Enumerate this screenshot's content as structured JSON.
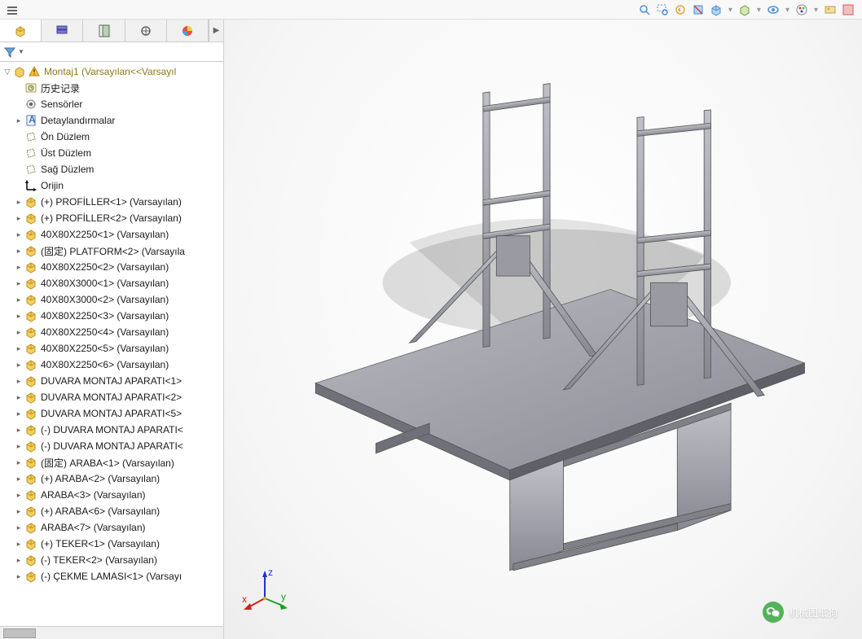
{
  "toolbar_right_icons": [
    "zoom-to-fit-icon",
    "zoom-area-icon",
    "previous-view-icon",
    "section-view-icon",
    "view-orient-icon",
    "display-style-icon",
    "hide-show-icon",
    "edit-appearance-icon",
    "apply-scene-icon",
    "view-settings-icon"
  ],
  "panel_tabs": [
    "assembly-tab-icon",
    "config-tab-icon",
    "property-tab-icon",
    "display-tab-icon",
    "appearance-tab-icon"
  ],
  "root": {
    "warn": true,
    "label": "Montaj1  (Varsayılan<<Varsayıl"
  },
  "tree": [
    {
      "icon": "history-icon",
      "label": "历史记录",
      "expand": false
    },
    {
      "icon": "sensor-icon",
      "label": "Sensörler",
      "expand": false
    },
    {
      "icon": "annot-icon",
      "label": "Detaylandırmalar",
      "expand": true
    },
    {
      "icon": "plane-icon",
      "label": "Ön Düzlem",
      "expand": false
    },
    {
      "icon": "plane-icon",
      "label": "Üst Düzlem",
      "expand": false
    },
    {
      "icon": "plane-icon",
      "label": "Sağ Düzlem",
      "expand": false
    },
    {
      "icon": "origin-icon",
      "label": "Orijin",
      "expand": false
    },
    {
      "icon": "part-icon",
      "label": "(+) PROFİLLER<1> (Varsayılan)",
      "expand": true
    },
    {
      "icon": "part-icon",
      "label": "(+) PROFİLLER<2> (Varsayılan)",
      "expand": true
    },
    {
      "icon": "part-icon",
      "label": "40X80X2250<1> (Varsayılan)",
      "expand": true
    },
    {
      "icon": "part-icon",
      "label": "(固定) PLATFORM<2> (Varsayıla",
      "expand": true
    },
    {
      "icon": "part-icon",
      "label": "40X80X2250<2> (Varsayılan)",
      "expand": true
    },
    {
      "icon": "part-icon",
      "label": "40X80X3000<1> (Varsayılan)",
      "expand": true
    },
    {
      "icon": "part-icon",
      "label": "40X80X3000<2> (Varsayılan)",
      "expand": true
    },
    {
      "icon": "part-icon",
      "label": "40X80X2250<3> (Varsayılan)",
      "expand": true
    },
    {
      "icon": "part-icon",
      "label": "40X80X2250<4> (Varsayılan)",
      "expand": true
    },
    {
      "icon": "part-icon",
      "label": "40X80X2250<5> (Varsayılan)",
      "expand": true
    },
    {
      "icon": "part-icon",
      "label": "40X80X2250<6> (Varsayılan)",
      "expand": true
    },
    {
      "icon": "part-icon",
      "label": "DUVARA MONTAJ APARATI<1>",
      "expand": true
    },
    {
      "icon": "part-icon",
      "label": "DUVARA MONTAJ APARATI<2>",
      "expand": true
    },
    {
      "icon": "part-icon",
      "label": "DUVARA MONTAJ APARATI<5>",
      "expand": true
    },
    {
      "icon": "part-icon",
      "label": "(-) DUVARA MONTAJ APARATI<",
      "expand": true
    },
    {
      "icon": "part-icon",
      "label": "(-) DUVARA MONTAJ APARATI<",
      "expand": true
    },
    {
      "icon": "part-icon",
      "label": "(固定) ARABA<1> (Varsayılan)",
      "expand": true
    },
    {
      "icon": "part-icon",
      "label": "(+) ARABA<2> (Varsayılan)",
      "expand": true
    },
    {
      "icon": "part-icon",
      "label": "ARABA<3> (Varsayılan)",
      "expand": true
    },
    {
      "icon": "part-icon",
      "label": "(+) ARABA<6> (Varsayılan)",
      "expand": true
    },
    {
      "icon": "part-icon",
      "label": "ARABA<7> (Varsayılan)",
      "expand": true
    },
    {
      "icon": "part-icon",
      "label": "(+) TEKER<1> (Varsayılan)",
      "expand": true
    },
    {
      "icon": "part-icon",
      "label": "(-) TEKER<2> (Varsayılan)",
      "expand": true
    },
    {
      "icon": "part-icon",
      "label": "(-) ÇEKME LAMASI<1> (Varsayı",
      "expand": true
    }
  ],
  "triad": {
    "x": "x",
    "y": "y",
    "z": "z"
  },
  "watermark": "机械图纸狗"
}
